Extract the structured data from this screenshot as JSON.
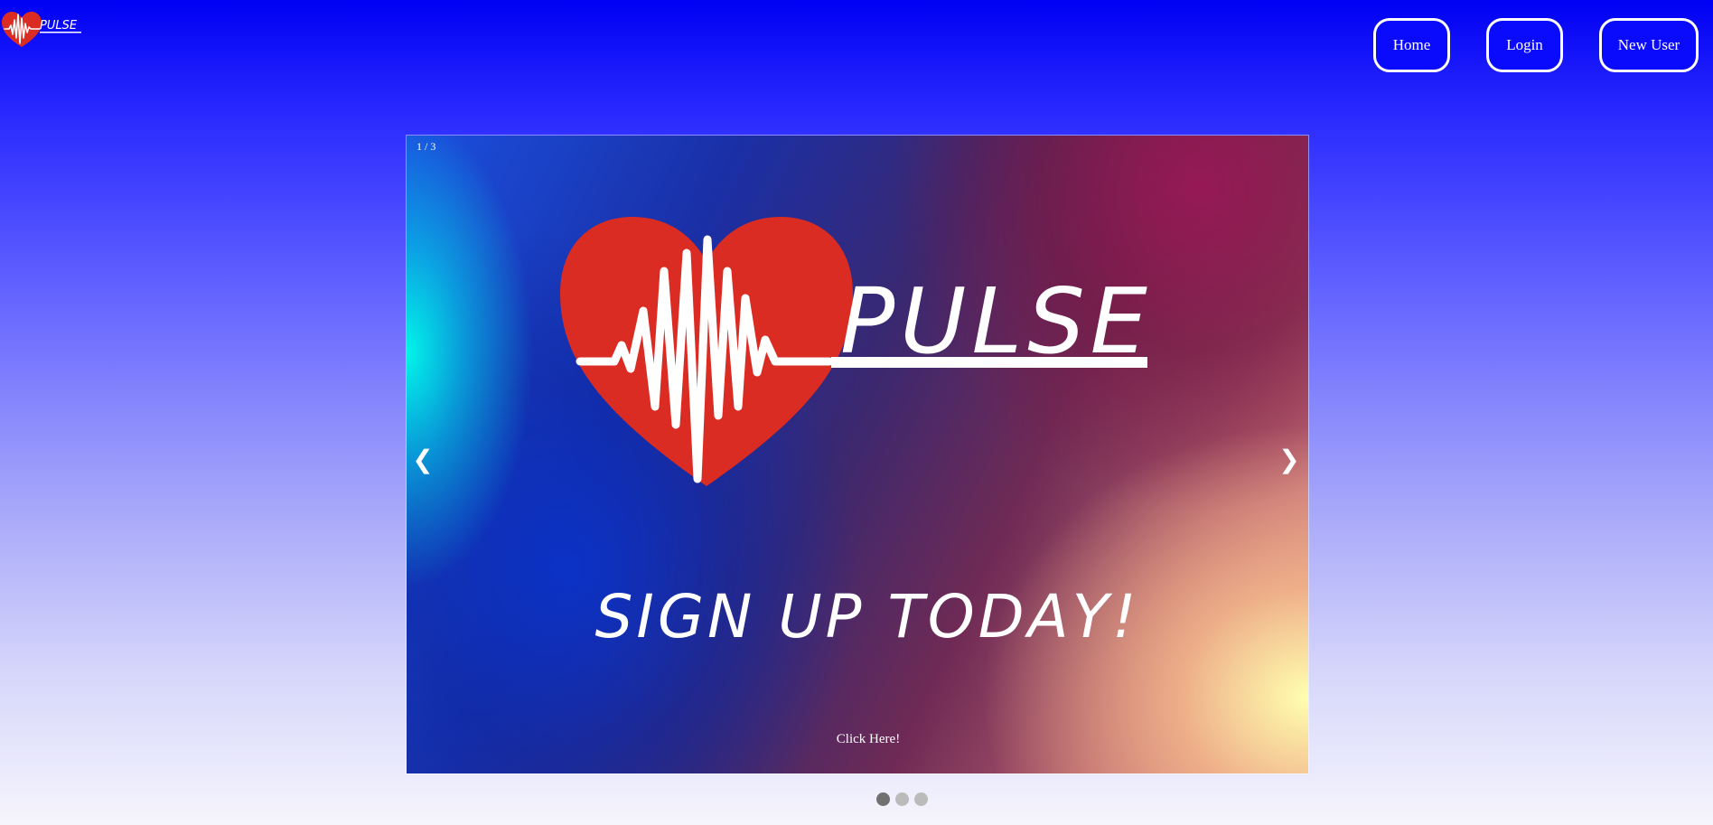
{
  "header": {
    "logo_text": "PULSE",
    "nav": [
      {
        "label": "Home"
      },
      {
        "label": "Login"
      },
      {
        "label": "New User"
      }
    ]
  },
  "slideshow": {
    "counter": "1 / 3",
    "current_slide": 1,
    "total_slides": 3,
    "prev_symbol": "❮",
    "next_symbol": "❯",
    "slide": {
      "brand_text": "PULSE",
      "headline": "SIGN UP TODAY!",
      "cta_label": "Click Here!"
    },
    "dots": [
      {
        "active": true
      },
      {
        "active": false
      },
      {
        "active": false
      }
    ]
  },
  "colors": {
    "accent_blue": "#0000f4",
    "heart_red": "#da2c23",
    "white": "#ffffff",
    "dot_active": "#717171",
    "dot_inactive": "#bbbbbb"
  },
  "icons": [
    "heart-pulse-logo-icon",
    "chevron-left-icon",
    "chevron-right-icon"
  ]
}
